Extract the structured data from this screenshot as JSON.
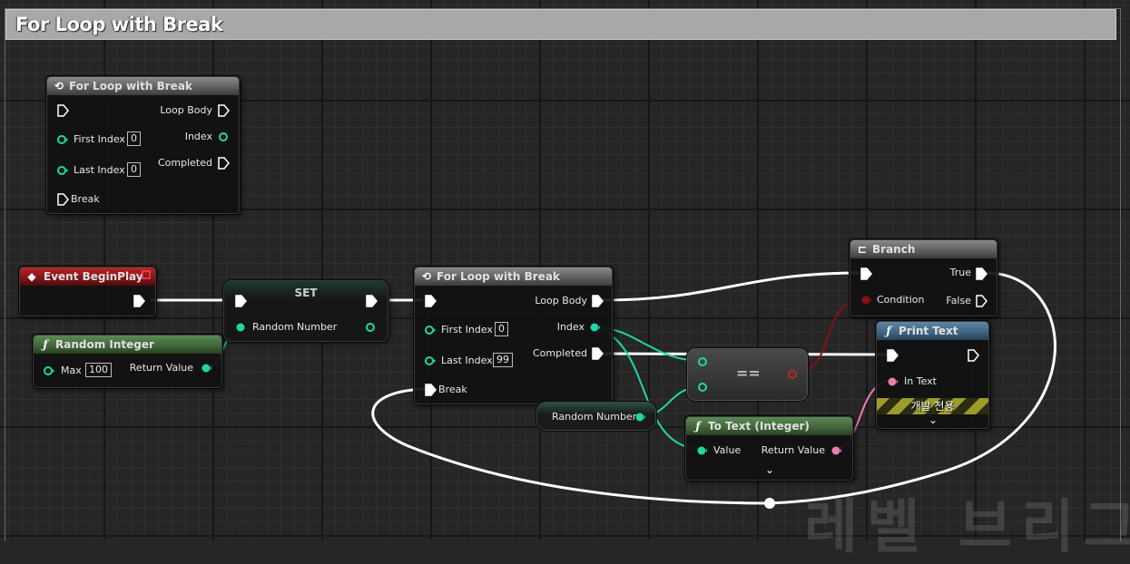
{
  "comment": {
    "title": "For Loop with Break"
  },
  "nodes": {
    "loop_ref": {
      "title": "For Loop with Break",
      "loop_body": "Loop Body",
      "first_index": "First Index",
      "first_index_value": "0",
      "index": "Index",
      "last_index": "Last Index",
      "last_index_value": "0",
      "completed": "Completed",
      "break": "Break"
    },
    "begin_play": {
      "title": "Event BeginPlay"
    },
    "random_integer": {
      "title": "Random Integer",
      "max": "Max",
      "max_value": "100",
      "return_value": "Return Value"
    },
    "set": {
      "title": "SET",
      "var": "Random Number"
    },
    "loop_main": {
      "title": "For Loop with Break",
      "loop_body": "Loop Body",
      "first_index": "First Index",
      "first_index_value": "0",
      "index": "Index",
      "last_index": "Last Index",
      "last_index_value": "99",
      "completed": "Completed",
      "break": "Break"
    },
    "random_number_getter": {
      "label": "Random Number"
    },
    "equals": {
      "symbol": "=="
    },
    "branch": {
      "title": "Branch",
      "true": "True",
      "condition": "Condition",
      "false": "False"
    },
    "print_text": {
      "title": "Print Text",
      "in_text": "In Text",
      "dev_only": "개발 전용"
    },
    "to_text": {
      "title": "To Text (Integer)",
      "value": "Value",
      "return_value": "Return Value"
    }
  },
  "watermark": "레벨 브리그",
  "colors": {
    "exec": "#ffffff",
    "integer": "#1ed7a8",
    "boolean": "#8c0f0f",
    "text": "#e87fb0",
    "background": "#262626"
  },
  "icons": {
    "loop": "loop-icon",
    "event": "event-diamond-icon",
    "function": "function-icon",
    "branch": "branch-icon",
    "collapse": "chevron-down-icon"
  }
}
